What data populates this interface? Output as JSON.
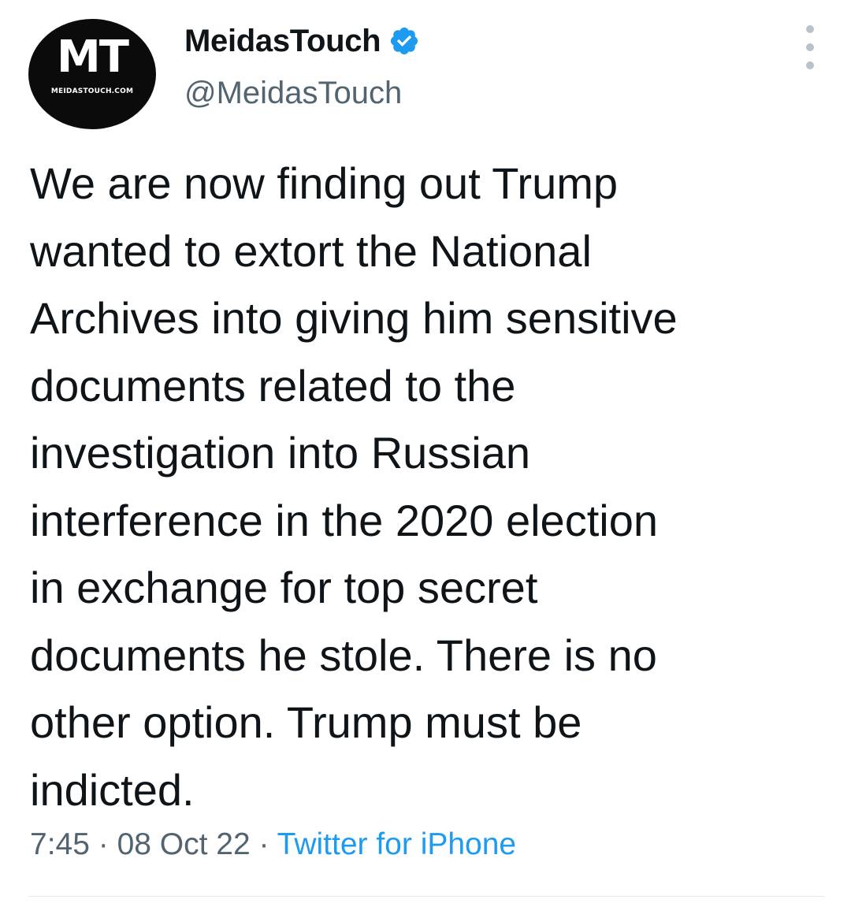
{
  "author": {
    "display_name": "MeidasTouch",
    "handle": "@MeidasTouch",
    "avatar_mark": "MT",
    "avatar_domain": "MEIDASTOUCH.COM",
    "verified": true,
    "verified_color": "#1d9bf0"
  },
  "tweet": {
    "text": "We are now finding out Trump\nwanted to extort the National\nArchives into giving him sensitive\ndocuments related to the\ninvestigation into Russian\ninterference in the 2020 election\nin exchange for top secret\ndocuments he stole. There is no\nother option. Trump must be\nindicted.",
    "time": "7:45",
    "separator": " · ",
    "date": "08 Oct 22",
    "source": "Twitter for iPhone"
  },
  "icons": {
    "more": "more-vertical-icon",
    "verified": "verified-badge-icon"
  },
  "colors": {
    "text": "#0f1419",
    "secondary": "#536471",
    "link": "#1d9bf0"
  }
}
